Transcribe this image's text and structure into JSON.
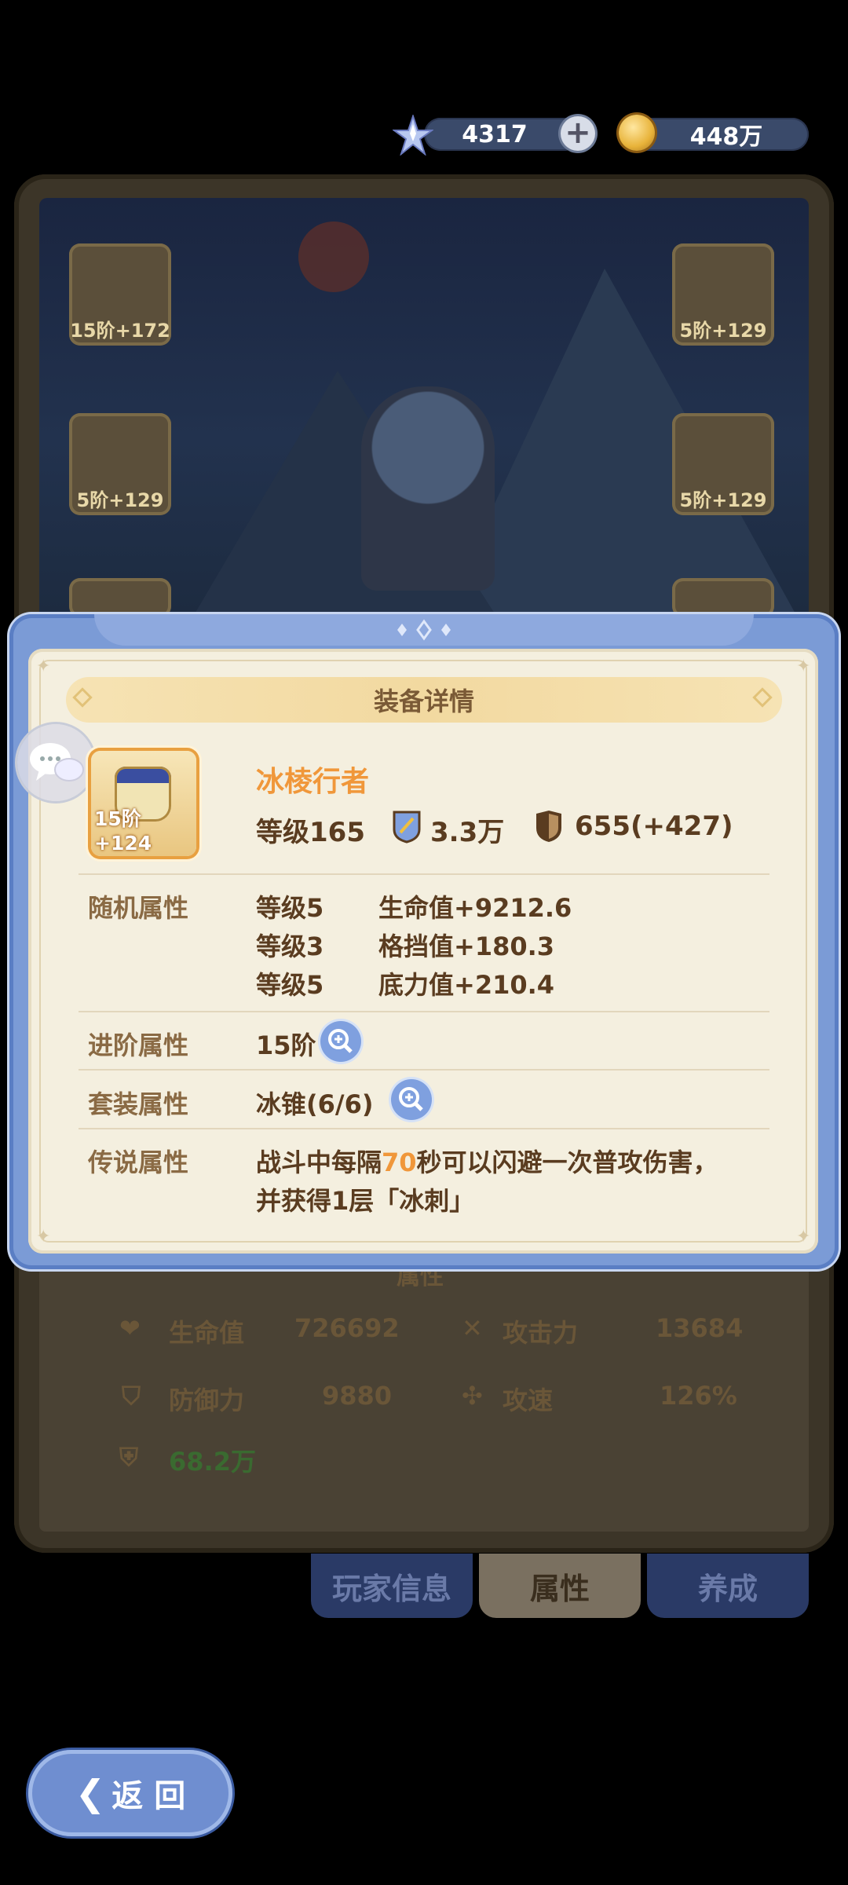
{
  "currency": {
    "gems": "4317",
    "gold": "448万"
  },
  "background": {
    "slots": {
      "top_left": "15阶+172",
      "top_right": "5阶+129",
      "mid_left": "5阶+129",
      "mid_right": "5阶+129"
    },
    "attributes_title": "属性",
    "attributes": {
      "hp_label": "生命值",
      "hp_value": "726692",
      "atk_label": "攻击力",
      "atk_value": "13684",
      "def_label": "防御力",
      "def_value": "9880",
      "spd_label": "攻速",
      "spd_value": "126%",
      "power_value": "68.2万"
    },
    "tabs": [
      "玩家信息",
      "属性",
      "养成"
    ]
  },
  "modal": {
    "title": "装备详情",
    "item": {
      "name": "冰棱行者",
      "tier": "15阶+124",
      "level": "等级165",
      "power": "3.3万",
      "defense": "655(+427)"
    },
    "random_attrs": {
      "label": "随机属性",
      "rows": [
        {
          "level": "等级5",
          "stat": "生命值+9212.6"
        },
        {
          "level": "等级3",
          "stat": "格挡值+180.3"
        },
        {
          "level": "等级5",
          "stat": "底力值+210.4"
        }
      ]
    },
    "advance": {
      "label": "进阶属性",
      "value": "15阶"
    },
    "set": {
      "label": "套装属性",
      "value": "冰锥(6/6)"
    },
    "legend": {
      "label": "传说属性",
      "line1_pre": "战斗中每隔",
      "line1_num": "70",
      "line1_post": "秒可以闪避一次普攻伤害，",
      "line2": "并获得1层「冰刺」"
    }
  },
  "back_button": "返 回"
}
